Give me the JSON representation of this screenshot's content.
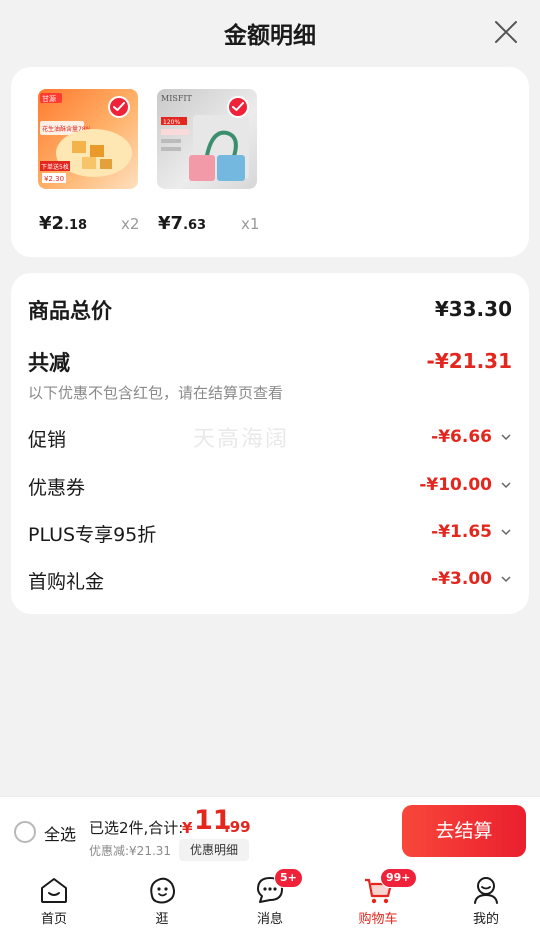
{
  "header": {
    "title": "金额明细"
  },
  "products": [
    {
      "price_int": "¥2",
      "price_dec": ".18",
      "qty": "x2",
      "thumb_colors": [
        "#ff8a3d",
        "#ffd9b3"
      ]
    },
    {
      "price_int": "¥7",
      "price_dec": ".63",
      "qty": "x1",
      "thumb_colors": [
        "#cfcfcf",
        "#f3f3f3"
      ]
    }
  ],
  "product1_texts": {
    "brand": "甘源",
    "spec": "花生油酥含量78%",
    "tag": "下单送5枚",
    "price": "¥2.30"
  },
  "product2_texts": {
    "brand": "MISFIT",
    "tag": "120%"
  },
  "summary": {
    "total_label": "商品总价",
    "total_value": "¥33.30",
    "discount_label": "共减",
    "discount_value": "-¥21.31",
    "note": "以下优惠不包含红包，请在结算页查看",
    "items": [
      {
        "label": "促销",
        "value": "-¥6.66"
      },
      {
        "label": "优惠券",
        "value": "-¥10.00"
      },
      {
        "label": "PLUS专享95折",
        "value": "-¥1.65"
      },
      {
        "label": "首购礼金",
        "value": "-¥3.00"
      }
    ],
    "watermark": "天高海阔"
  },
  "bottom": {
    "select_all": "全选",
    "selected_text": "已选2件,合计:",
    "total_yen": "¥",
    "total_int": "11",
    "total_dec": ".99",
    "discount_small": "优惠减:¥21.31",
    "detail_tag": "优惠明细",
    "checkout": "去结算"
  },
  "tabs": [
    {
      "label": "首页",
      "icon": "home-icon"
    },
    {
      "label": "逛",
      "icon": "browse-icon"
    },
    {
      "label": "消息",
      "icon": "message-icon",
      "badge": "5+"
    },
    {
      "label": "购物车",
      "icon": "cart-icon",
      "badge": "99+",
      "active": true
    },
    {
      "label": "我的",
      "icon": "profile-icon"
    }
  ],
  "colors": {
    "accent": "#e3261e",
    "badge": "#f0223a"
  }
}
